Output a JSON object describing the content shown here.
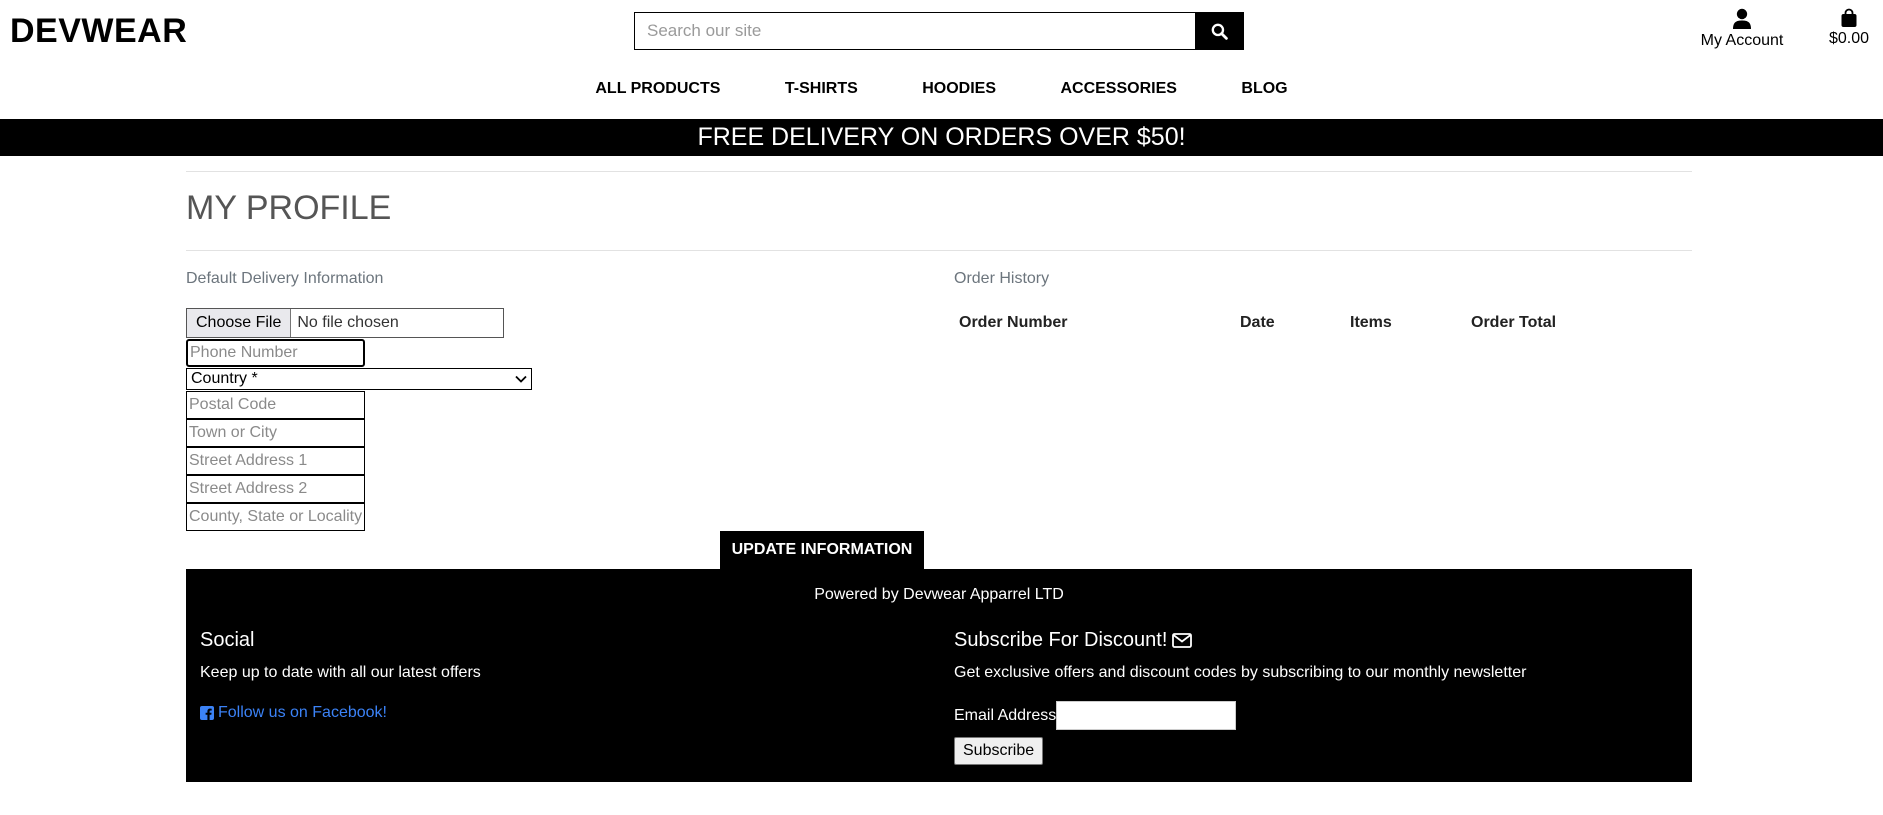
{
  "header": {
    "logo": "DEVWEAR",
    "search_placeholder": "Search our site",
    "account_label": "My Account",
    "cart_total": "$0.00"
  },
  "nav": {
    "items": [
      "ALL PRODUCTS",
      "T-SHIRTS",
      "HOODIES",
      "ACCESSORIES",
      "BLOG"
    ]
  },
  "banner": "FREE DELIVERY ON ORDERS OVER $50!",
  "profile": {
    "title": "MY PROFILE",
    "delivery_heading": "Default Delivery Information",
    "file_button": "Choose File",
    "file_status": "No file chosen",
    "phone_placeholder": "Phone Number",
    "country_label": "Country *",
    "postcode_placeholder": "Postal Code",
    "town_placeholder": "Town or City",
    "street1_placeholder": "Street Address 1",
    "street2_placeholder": "Street Address 2",
    "county_placeholder": "County, State or Locality",
    "update_button": "UPDATE INFORMATION"
  },
  "orders": {
    "heading": "Order History",
    "columns": [
      "Order Number",
      "Date",
      "Items",
      "Order Total"
    ]
  },
  "footer": {
    "powered": "Powered by Devwear Apparrel LTD",
    "social_title": "Social",
    "social_text": "Keep up to date with all our latest offers",
    "facebook_link": "Follow us on Facebook!",
    "subscribe_title": "Subscribe For Discount!",
    "subscribe_text": "Get exclusive offers and discount codes by subscribing to our monthly newsletter",
    "email_label": "Email Address",
    "subscribe_button": "Subscribe"
  },
  "colors": {
    "link": "#3b82f6",
    "banner_bg": "#000000",
    "heading_grey": "#555555"
  }
}
